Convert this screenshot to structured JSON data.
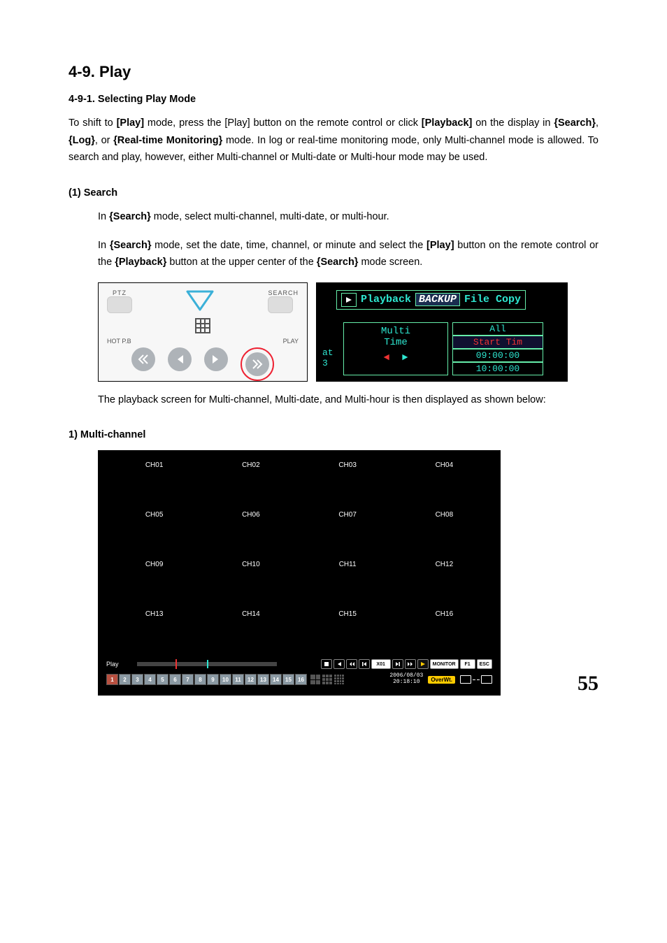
{
  "section": {
    "title": "4-9. Play",
    "sub1": "4-9-1. Selecting Play Mode",
    "intro_parts": {
      "p1a": "To shift to ",
      "p1b": "[Play]",
      "p1c": " mode, press the [Play] button on the remote control or click ",
      "p1d": "[Playback]",
      "p1e": " on the display in ",
      "p1f": "{Search}",
      "p1g": ", ",
      "p1h": "{Log}",
      "p1i": ", or ",
      "p1j": "{Real-time Monitoring}",
      "p1k": " mode. In log or real-time monitoring mode, only Multi-channel mode is allowed. To search and play, however, either Multi-channel or Multi-date or Multi-hour mode may be used."
    },
    "search_heading": "(1) Search",
    "search_p1a": "In ",
    "search_p1b": "{Search}",
    "search_p1c": " mode, select multi-channel, multi-date, or multi-hour.",
    "search_p2a": "In ",
    "search_p2b": "{Search}",
    "search_p2c": " mode, set the date, time, channel, or minute and select the ",
    "search_p2d": "[Play]",
    "search_p2e": " button on the remote control or the ",
    "search_p2f": "{Playback}",
    "search_p2g": " button at the upper center of the ",
    "search_p2h": "{Search}",
    "search_p2i": " mode screen.",
    "after_fig": "The playback screen for Multi-channel, Multi-date, and Multi-hour is then displayed as shown below:",
    "mc_heading": "1) Multi-channel"
  },
  "remote_fig": {
    "ptz": "PTZ",
    "search": "SEARCH",
    "hotpb": "HOT P.B",
    "play": "PLAY"
  },
  "playback_panel": {
    "playback": "Playback",
    "backup": "BACKUP",
    "filecopy": "File Copy",
    "multi": "Multi",
    "time": "Time",
    "at": "at",
    "three": "3",
    "all": "All",
    "start": "Start Tim",
    "t1": "09:00:00",
    "t2": "10:00:00",
    "left_arrow": "◄",
    "right_arrow": "►"
  },
  "mc_screen": {
    "channels": [
      "CH01",
      "CH02",
      "CH03",
      "CH04",
      "CH05",
      "CH06",
      "CH07",
      "CH08",
      "CH09",
      "CH10",
      "CH11",
      "CH12",
      "CH13",
      "CH14",
      "CH15",
      "CH16"
    ],
    "play_label": "Play",
    "speed": "X01",
    "monitor": "MONITOR",
    "f1": "F1",
    "esc": "ESC",
    "date": "2006/08/03",
    "time": "20:18:10",
    "overwrite": "OverWt.",
    "numbers": [
      "1",
      "2",
      "3",
      "4",
      "5",
      "6",
      "7",
      "8",
      "9",
      "10",
      "11",
      "12",
      "13",
      "14",
      "15",
      "16"
    ]
  },
  "page_number": "55"
}
